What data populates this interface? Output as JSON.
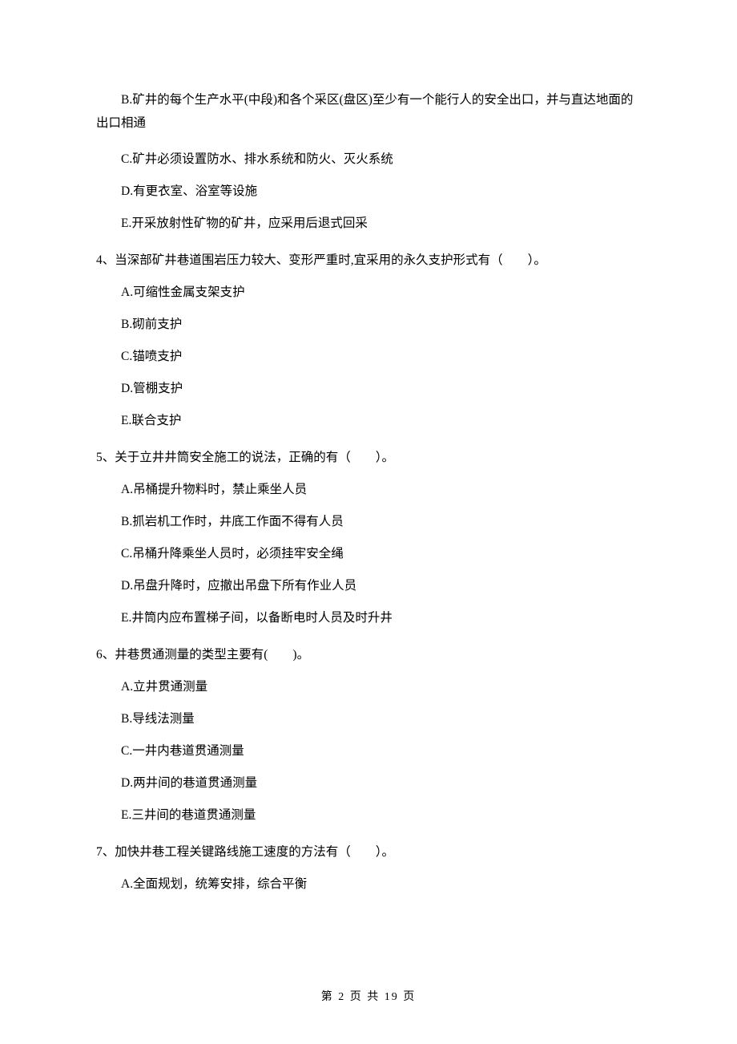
{
  "q3_tail": {
    "optB": "B.矿井的每个生产水平(中段)和各个采区(盘区)至少有一个能行人的安全出口，并与直达地面的出口相通",
    "optC": "C.矿井必须设置防水、排水系统和防火、灭火系统",
    "optD": "D.有更衣室、浴室等设施",
    "optE": "E.开采放射性矿物的矿井，应采用后退式回采"
  },
  "q4": {
    "stem": "4、当深部矿井巷道围岩压力较大、变形严重时,宜采用的永久支护形式有（　　）。",
    "optA": "A.可缩性金属支架支护",
    "optB": "B.砌前支护",
    "optC": "C.锚喷支护",
    "optD": "D.管棚支护",
    "optE": "E.联合支护"
  },
  "q5": {
    "stem": "5、关于立井井筒安全施工的说法，正确的有（　　）。",
    "optA": "A.吊桶提升物料时，禁止乘坐人员",
    "optB": "B.抓岩机工作时，井底工作面不得有人员",
    "optC": "C.吊桶升降乘坐人员时，必须挂牢安全绳",
    "optD": "D.吊盘升降时，应撤出吊盘下所有作业人员",
    "optE": "E.井筒内应布置梯子间，以备断电时人员及时升井"
  },
  "q6": {
    "stem": "6、井巷贯通测量的类型主要有(　　)。",
    "optA": "A.立井贯通测量",
    "optB": "B.导线法测量",
    "optC": "C.一井内巷道贯通测量",
    "optD": "D.两井间的巷道贯通测量",
    "optE": "E.三井间的巷道贯通测量"
  },
  "q7": {
    "stem": "7、加快井巷工程关键路线施工速度的方法有（　　）。",
    "optA": "A.全面规划，统筹安排，综合平衡"
  },
  "footer": "第 2 页 共 19 页"
}
